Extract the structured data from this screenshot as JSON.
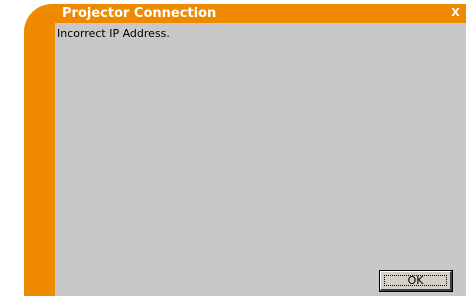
{
  "window": {
    "title": "Projector Connection",
    "close_label": "X"
  },
  "message": "Incorrect IP Address.",
  "buttons": {
    "ok_label": "OK"
  },
  "colors": {
    "frame": "#ef8a00",
    "content_background": "#c8c8c8",
    "title_text": "#ffffff"
  }
}
